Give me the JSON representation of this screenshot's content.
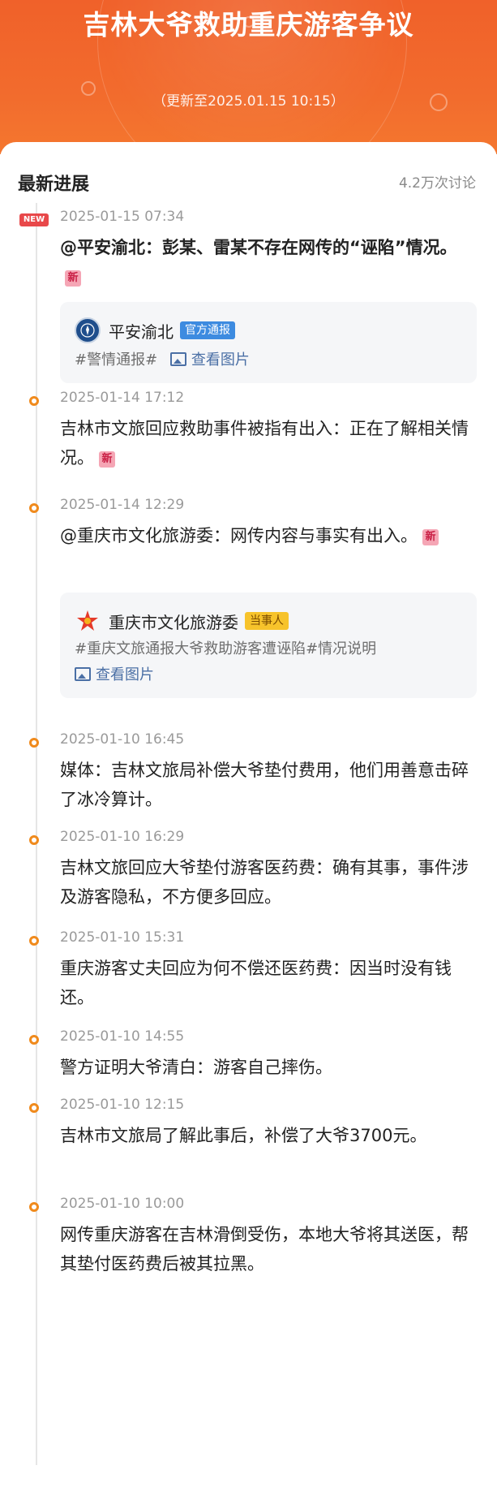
{
  "header": {
    "title": "吉林大爷救助重庆游客争议",
    "update": "（更新至2025.01.15 10:15）"
  },
  "section": {
    "title": "最新进展",
    "discussion_count": "4.2万次讨论"
  },
  "new_tag": "NEW",
  "new_badge": "新",
  "entries": [
    {
      "time": "2025-01-15 07:34",
      "text": "@平安渝北：彭某、雷某不存在网传的“诬陷”情况。",
      "source": {
        "name": "平安渝北",
        "badge": "官方通报",
        "hashtag": "#警情通报#",
        "view_images": "查看图片"
      }
    },
    {
      "time": "2025-01-14 17:12",
      "text": "吉林市文旅回应救助事件被指有出入：正在了解相关情况。"
    },
    {
      "time": "2025-01-14 12:29",
      "text": "@重庆市文化旅游委：网传内容与事实有出入。",
      "source": {
        "name": "重庆市文化旅游委",
        "badge": "当事人",
        "hashtag": "#重庆文旅通报大爷救助游客遭诬陷#情况说明",
        "view_images": "查看图片"
      }
    },
    {
      "time": "2025-01-10 16:45",
      "text": "媒体：吉林文旅局补偿大爷垫付费用，他们用善意击碎了冰冷算计。"
    },
    {
      "time": "2025-01-10 16:29",
      "text": "吉林文旅回应大爷垫付游客医药费：确有其事，事件涉及游客隐私，不方便多回应。"
    },
    {
      "time": "2025-01-10 15:31",
      "text": "重庆游客丈夫回应为何不偿还医药费：因当时没有钱还。"
    },
    {
      "time": "2025-01-10 14:55",
      "text": "警方证明大爷清白：游客自己摔伤。"
    },
    {
      "time": "2025-01-10 12:15",
      "text": "吉林市文旅局了解此事后，补偿了大爷3700元。"
    },
    {
      "time": "2025-01-10 10:00",
      "text": "网传重庆游客在吉林滑倒受伤，本地大爷将其送医，帮其垫付医药费后被其拉黑。"
    }
  ],
  "colors": {
    "header_bg": "#f26b2d",
    "marker": "#f08a1c",
    "new_tag": "#e8484a",
    "link": "#4a6fa5"
  },
  "icons": {
    "marker": "timeline-dot-icon",
    "image": "image-icon",
    "police_logo": "police-emblem-icon",
    "tourism_logo": "tourism-logo-icon"
  }
}
